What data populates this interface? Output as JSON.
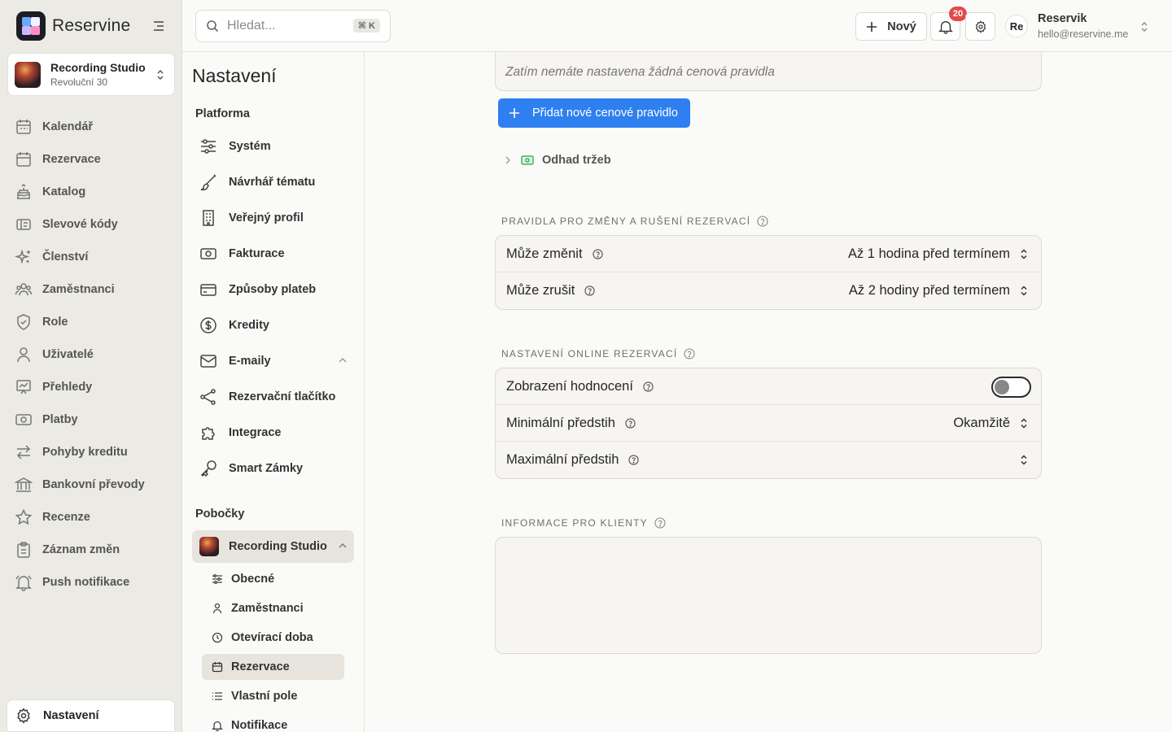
{
  "app": {
    "brand": "Reservine"
  },
  "colors": {
    "accent": "#2e7ff0",
    "badge": "#e24b4b",
    "sidebar_bg": "#ebeae4"
  },
  "studio": {
    "name": "Recording Studio",
    "address": "Revoluční 30"
  },
  "nav": [
    {
      "label": "Kalendář",
      "icon": "calendar-icon"
    },
    {
      "label": "Rezervace",
      "icon": "calendar-check-icon"
    },
    {
      "label": "Katalog",
      "icon": "cake-icon"
    },
    {
      "label": "Slevové kódy",
      "icon": "ticket-icon"
    },
    {
      "label": "Členství",
      "icon": "sparkles-icon"
    },
    {
      "label": "Zaměstnanci",
      "icon": "users-icon"
    },
    {
      "label": "Role",
      "icon": "shield-icon"
    },
    {
      "label": "Uživatelé",
      "icon": "user-icon"
    },
    {
      "label": "Přehledy",
      "icon": "chart-icon"
    },
    {
      "label": "Platby",
      "icon": "banknote-icon"
    },
    {
      "label": "Pohyby kreditu",
      "icon": "arrows-icon"
    },
    {
      "label": "Bankovní převody",
      "icon": "bank-icon"
    },
    {
      "label": "Recenze",
      "icon": "star-icon"
    },
    {
      "label": "Záznam změn",
      "icon": "clipboard-icon"
    },
    {
      "label": "Push notifikace",
      "icon": "bell-icon"
    }
  ],
  "sidebar_bottom": {
    "label": "Nastavení"
  },
  "topbar": {
    "search_placeholder": "Hledat...",
    "search_shortcut": "⌘ K",
    "new_label": "Nový",
    "notifications_count": "20",
    "user_initials": "Re",
    "user_name": "Reservik",
    "user_email": "hello@reservine.me"
  },
  "settings_menu": {
    "title": "Nastavení",
    "platform_label": "Platforma",
    "platform_items": [
      {
        "label": "Systém",
        "icon": "sliders-icon"
      },
      {
        "label": "Návrhář tématu",
        "icon": "brush-icon"
      },
      {
        "label": "Veřejný profil",
        "icon": "building-icon"
      },
      {
        "label": "Fakturace",
        "icon": "banknote-icon"
      },
      {
        "label": "Způsoby plateb",
        "icon": "credit-card-icon"
      },
      {
        "label": "Kredity",
        "icon": "dollar-circle-icon"
      },
      {
        "label": "E-maily",
        "icon": "mail-icon"
      },
      {
        "label": "Rezervační tlačítko",
        "icon": "share-icon"
      },
      {
        "label": "Integrace",
        "icon": "puzzle-icon"
      },
      {
        "label": "Smart Zámky",
        "icon": "key-icon"
      }
    ],
    "branches_label": "Pobočky",
    "branch": {
      "label": "Recording Studio"
    },
    "branch_items": [
      {
        "label": "Obecné",
        "icon": "sliders-icon"
      },
      {
        "label": "Zaměstnanci",
        "icon": "user-icon"
      },
      {
        "label": "Otevírací doba",
        "icon": "clock-icon"
      },
      {
        "label": "Rezervace",
        "icon": "calendar-icon"
      },
      {
        "label": "Vlastní pole",
        "icon": "list-icon"
      },
      {
        "label": "Notifikace",
        "icon": "bell-icon"
      }
    ]
  },
  "main": {
    "empty_rules": "Zatím nemáte nastavena žádná cenová pravidla",
    "add_rule_label": "Přidat nové cenové pravidlo",
    "estimate_label": "Odhad tržeb",
    "change_section": {
      "title": "PRAVIDLA PRO ZMĚNY A RUŠENÍ REZERVACÍ",
      "rows": [
        {
          "label": "Může změnit",
          "value": "Až 1 hodina před termínem"
        },
        {
          "label": "Může zrušit",
          "value": "Až 2 hodiny před termínem"
        }
      ]
    },
    "online_section": {
      "title": "NASTAVENÍ ONLINE REZERVACÍ",
      "rows": [
        {
          "label": "Zobrazení hodnocení",
          "value": ""
        },
        {
          "label": "Minimální předstih",
          "value": "Okamžitě"
        },
        {
          "label": "Maximální předstih",
          "value": ""
        }
      ]
    },
    "info_section": {
      "title": "INFORMACE PRO KLIENTY",
      "value": ""
    }
  }
}
